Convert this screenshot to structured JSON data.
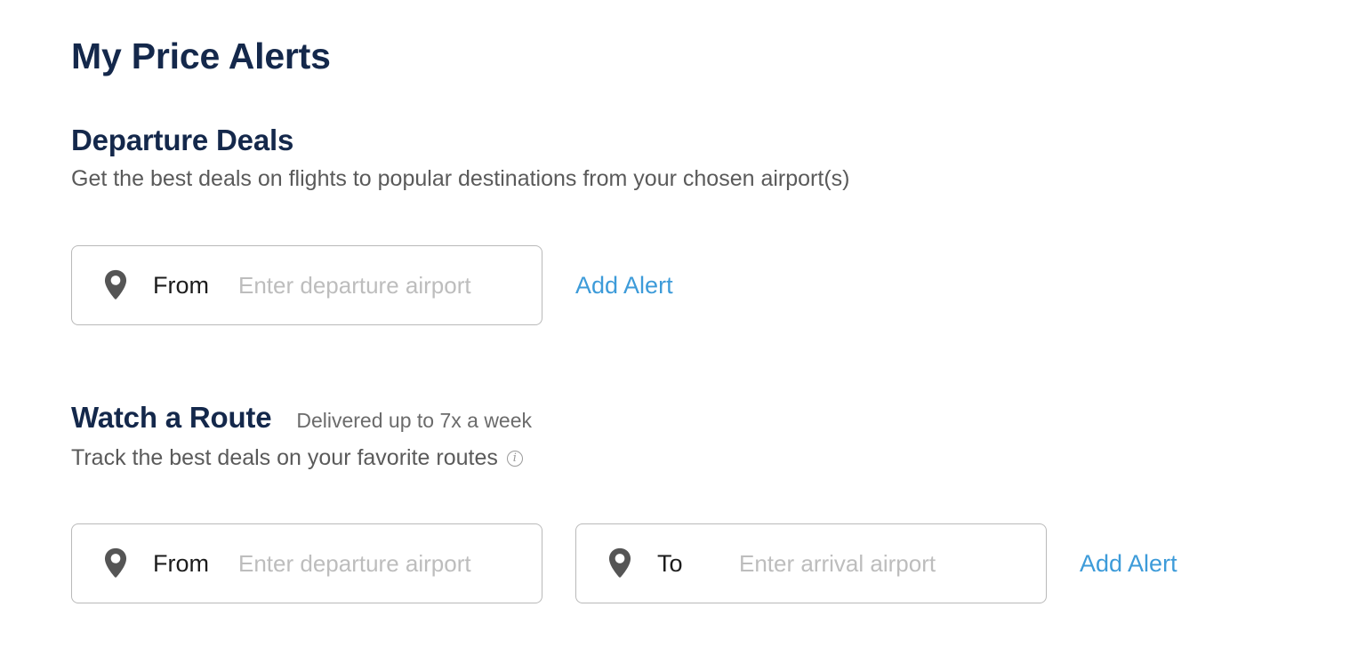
{
  "page": {
    "title": "My Price Alerts"
  },
  "departure_deals": {
    "title": "Departure Deals",
    "description": "Get the best deals on flights to popular destinations from your chosen airport(s)",
    "from_field": {
      "label": "From",
      "placeholder": "Enter departure airport",
      "value": "",
      "icon": "location-pin-icon"
    },
    "add_alert_label": "Add Alert"
  },
  "watch_route": {
    "title": "Watch a Route",
    "subtitle": "Delivered up to 7x a week",
    "description": "Track the best deals on your favorite routes",
    "info_icon": "info-icon",
    "from_field": {
      "label": "From",
      "placeholder": "Enter departure airport",
      "value": "",
      "icon": "location-pin-icon"
    },
    "to_field": {
      "label": "To",
      "placeholder": "Enter arrival airport",
      "value": "",
      "icon": "location-pin-icon"
    },
    "add_alert_label": "Add Alert"
  },
  "colors": {
    "heading": "#14284b",
    "body_text": "#5a5a5a",
    "link": "#3d9bd9",
    "field_border": "#b9b9b9",
    "placeholder": "#bdbdbd",
    "icon": "#555555"
  }
}
